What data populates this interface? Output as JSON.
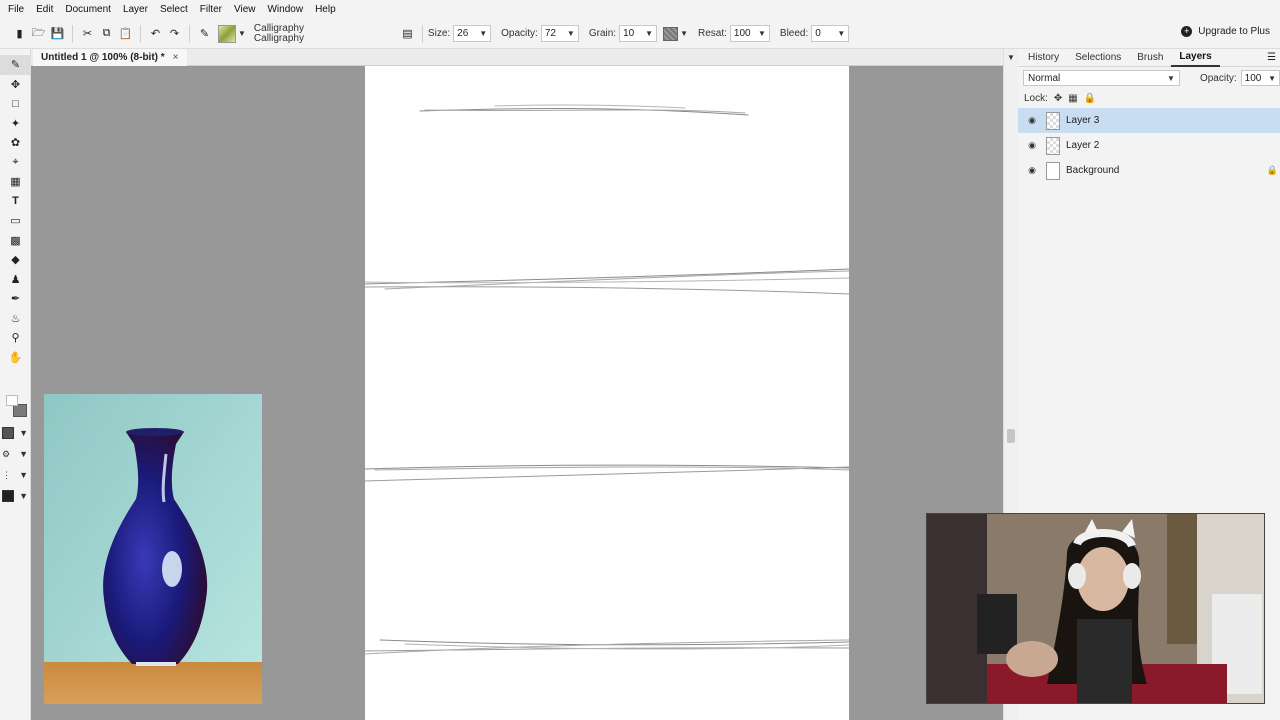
{
  "menu": [
    "File",
    "Edit",
    "Document",
    "Layer",
    "Select",
    "Filter",
    "View",
    "Window",
    "Help"
  ],
  "options_bar": {
    "brush_preset_line1": "Calligraphy",
    "brush_preset_line2": "Calligraphy",
    "size_label": "Size:",
    "size_value": "26",
    "opacity_label": "Opacity:",
    "opacity_value": "72",
    "grain_label": "Grain:",
    "grain_value": "10",
    "resat_label": "Resat:",
    "resat_value": "100",
    "bleed_label": "Bleed:",
    "bleed_value": "0",
    "upgrade_label": "Upgrade to Plus"
  },
  "toolbar": {
    "tools": [
      "brush-icon",
      "move-icon",
      "marquee-icon",
      "magic-wand-icon",
      "lasso-icon",
      "crop-icon",
      "slice-icon",
      "text-icon",
      "shape-icon",
      "gradient-icon",
      "eraser-icon",
      "clone-stamp-icon",
      "eyedropper-icon",
      "paint-bucket-icon",
      "zoom-icon",
      "hand-icon"
    ],
    "active_tool": "brush-icon",
    "foreground_color": "#ffffff",
    "background_color": "#7a7a7a"
  },
  "document_tab": {
    "title": "Untitled 1 @ 100% (8-bit) *",
    "close": "×"
  },
  "right_panel": {
    "tabs": [
      "History",
      "Selections",
      "Brush",
      "Layers"
    ],
    "active_tab": "Layers",
    "blend_mode": "Normal",
    "opacity_label": "Opacity:",
    "opacity_value": "100",
    "lock_label": "Lock:",
    "layers": [
      {
        "name": "Layer 3",
        "selected": true,
        "locked": false
      },
      {
        "name": "Layer 2",
        "selected": false,
        "locked": false
      },
      {
        "name": "Background",
        "selected": false,
        "locked": true
      }
    ]
  },
  "colors": {
    "accent_selection": "#c8dcf2",
    "workspace": "#989898",
    "panel": "#f3f3f3"
  }
}
